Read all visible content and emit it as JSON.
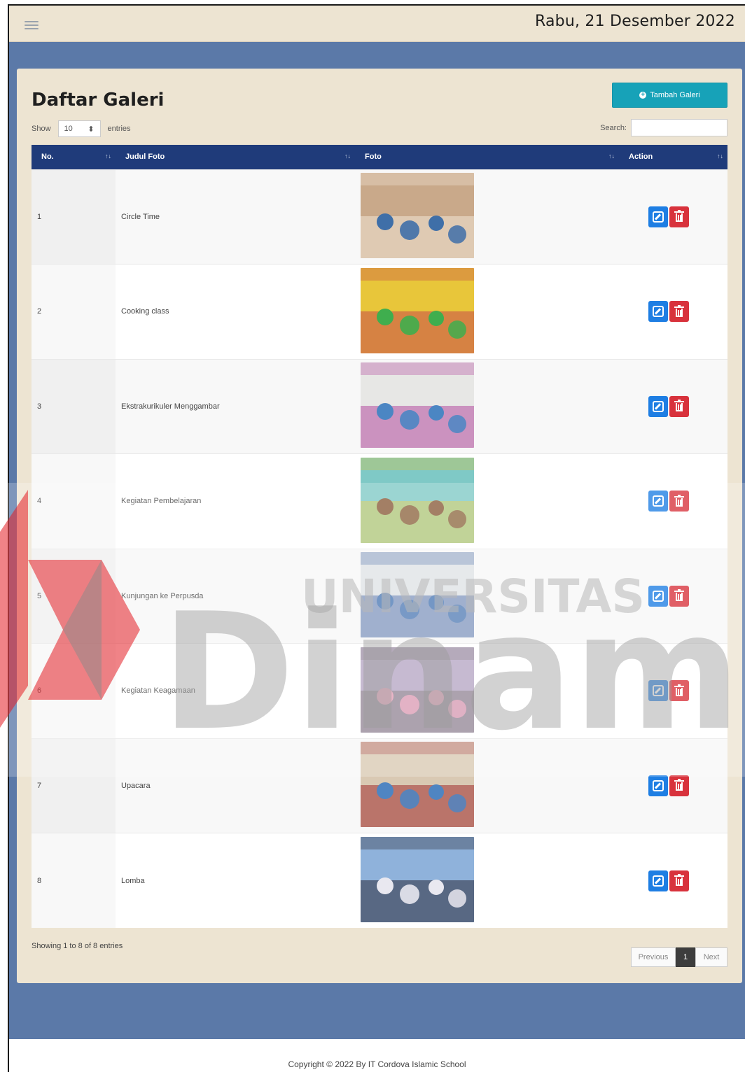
{
  "header": {
    "date": "Rabu, 21 Desember 2022"
  },
  "page": {
    "title": "Daftar Galeri",
    "add_button": "Tambah Galeri"
  },
  "table_controls": {
    "show_label": "Show",
    "length_value": "10",
    "entries_label": "entries",
    "search_label": "Search:"
  },
  "columns": [
    "No.",
    "Judul Foto",
    "Foto",
    "Action"
  ],
  "rows": [
    {
      "no": "1",
      "title": "Circle Time",
      "palette": [
        "#c9a98a",
        "#3f6fa8",
        "#f0e6d6"
      ]
    },
    {
      "no": "2",
      "title": "Cooking class",
      "palette": [
        "#e8c63a",
        "#3fae4e",
        "#c64a4a"
      ]
    },
    {
      "no": "3",
      "title": "Ekstrakurikuler Menggambar",
      "palette": [
        "#e7e7e5",
        "#4b86c3",
        "#b44da0"
      ]
    },
    {
      "no": "4",
      "title": "Kegiatan Pembelajaran",
      "palette": [
        "#7fc9c6",
        "#8a5b3a",
        "#d9c43e"
      ]
    },
    {
      "no": "5",
      "title": "Kunjungan ke Perpusda",
      "palette": [
        "#dfe3e6",
        "#4d7ab5",
        "#3d5fa0"
      ]
    },
    {
      "no": "6",
      "title": "Kegiatan Keagamaan",
      "palette": [
        "#b6a7c4",
        "#e3a0b8",
        "#7a6f75"
      ]
    },
    {
      "no": "7",
      "title": "Upacara",
      "palette": [
        "#d9c9b3",
        "#4f85c2",
        "#a12d2d"
      ]
    },
    {
      "no": "8",
      "title": "Lomba",
      "palette": [
        "#8fb2db",
        "#e9e8f0",
        "#2c2c3a"
      ]
    }
  ],
  "footer_info": "Showing 1 to 8 of 8 entries",
  "pagination": {
    "previous": "Previous",
    "current": "1",
    "next": "Next"
  },
  "copyright": "Copyright © 2022 By IT Cordova Islamic School",
  "watermark": {
    "line1": "UNIVERSITAS",
    "line2": "Dinamika"
  },
  "colors": {
    "header_bg": "#1f3b7a",
    "edit": "#1e7ee3",
    "delete": "#d8323c",
    "accent": "#17a2b8"
  }
}
